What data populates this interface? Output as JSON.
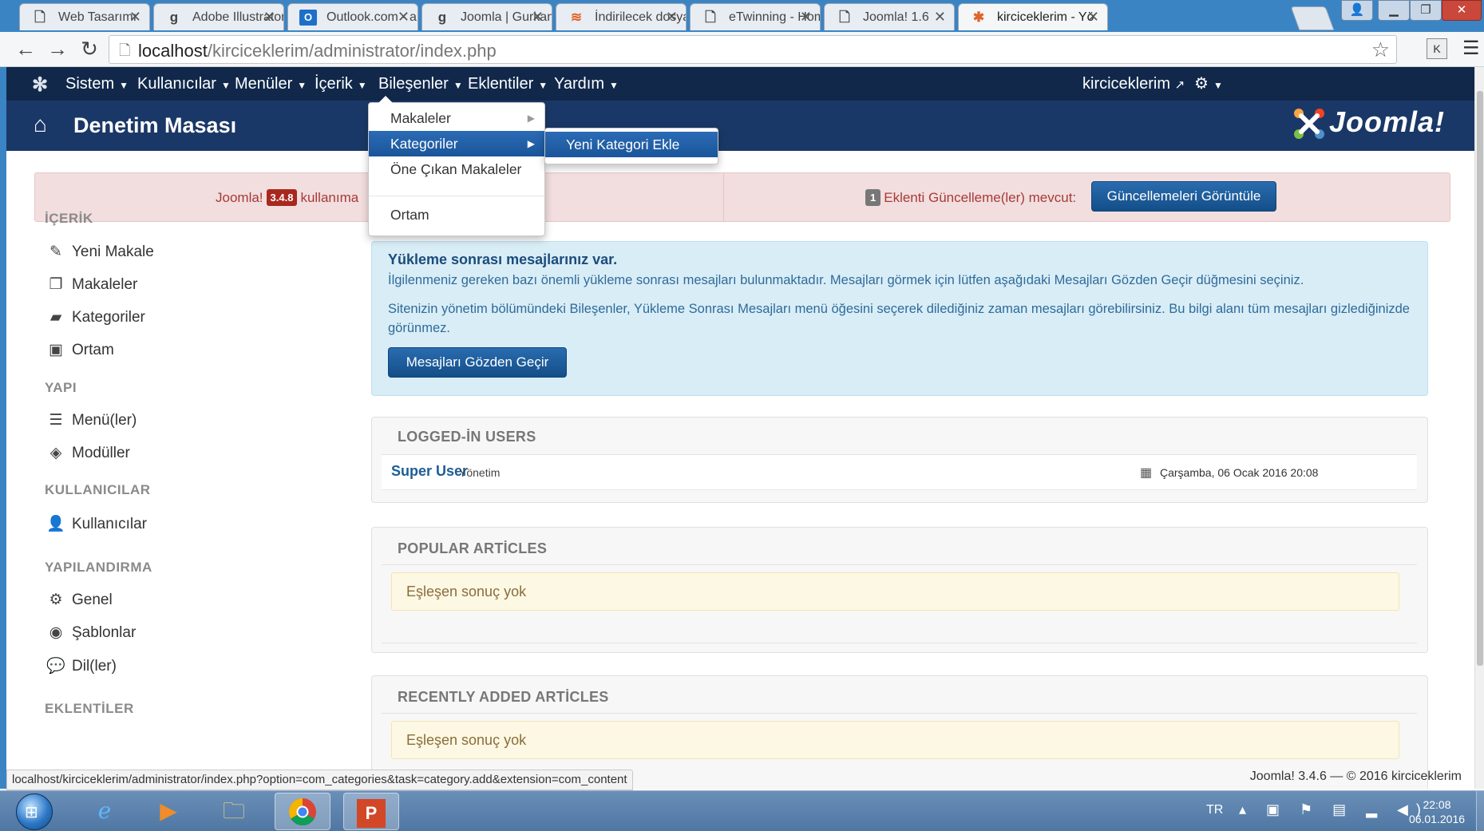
{
  "browser": {
    "tabs": [
      {
        "title": "Web Tasarımı",
        "icon": "page-icon"
      },
      {
        "title": "Adobe Illustrator",
        "icon": "g-icon"
      },
      {
        "title": "Outlook.com - ah",
        "icon": "outlook-icon"
      },
      {
        "title": "Joomla | Gurkanc",
        "icon": "g-icon"
      },
      {
        "title": "İndirilecek dosya",
        "icon": "stack-icon"
      },
      {
        "title": "eTwinning - Hom",
        "icon": "page-icon"
      },
      {
        "title": "Joomla! 1.6",
        "icon": "page-icon"
      },
      {
        "title": "kirciceklerim - Yö",
        "icon": "joomla-icon"
      }
    ],
    "url_host": "localhost",
    "url_path": "/kirciceklerim/administrator/index.php",
    "status_url": "localhost/kirciceklerim/administrator/index.php?option=com_categories&task=category.add&extension=com_content",
    "ext_label": "K"
  },
  "topmenu": {
    "items": [
      "Sistem",
      "Kullanıcılar",
      "Menüler",
      "İçerik",
      "Bileşenler",
      "Eklentiler",
      "Yardım"
    ],
    "site_link": "kirciceklerim"
  },
  "header": {
    "title": "Denetim Masası",
    "brand": "Joomla!"
  },
  "alert": {
    "left_prefix": "Joomla!",
    "version_badge": "3.4.8",
    "left_suffix": "kullanıma",
    "count_badge": "1",
    "right_text": "Eklenti Güncelleme(ler) mevcut:",
    "button": "Güncellemeleri Görüntüle"
  },
  "dropdown": {
    "items": [
      "Makaleler",
      "Kategoriler",
      "Öne Çıkan Makaleler",
      "Ortam"
    ],
    "submenu_item": "Yeni Kategori Ekle"
  },
  "sidebar": {
    "sections": [
      {
        "heading": "İÇERİK",
        "items": [
          {
            "label": "Yeni Makale",
            "icon": "pencil-icon"
          },
          {
            "label": "Makaleler",
            "icon": "copy-icon"
          },
          {
            "label": "Kategoriler",
            "icon": "folder-icon"
          },
          {
            "label": "Ortam",
            "icon": "image-icon"
          }
        ]
      },
      {
        "heading": "YAPI",
        "items": [
          {
            "label": "Menü(ler)",
            "icon": "list-icon"
          },
          {
            "label": "Modüller",
            "icon": "cube-icon"
          }
        ]
      },
      {
        "heading": "KULLANICILAR",
        "items": [
          {
            "label": "Kullanıcılar",
            "icon": "user-icon"
          }
        ]
      },
      {
        "heading": "YAPILANDIRMA",
        "items": [
          {
            "label": "Genel",
            "icon": "gear-icon"
          },
          {
            "label": "Şablonlar",
            "icon": "eye-icon"
          },
          {
            "label": "Dil(ler)",
            "icon": "comments-icon"
          }
        ]
      },
      {
        "heading": "EKLENTİLER",
        "items": []
      }
    ]
  },
  "postinstall": {
    "title": "Yükleme sonrası mesajlarınız var.",
    "p1": "İlgilenmeniz gereken bazı önemli yükleme sonrası mesajları bulunmaktadır. Mesajları görmek için lütfen aşağıdaki Mesajları Gözden Geçir düğmesini seçiniz.",
    "p2": "Sitenizin yönetim bölümündeki Bileşenler, Yükleme Sonrası Mesajları menü öğesini seçerek dilediğiniz zaman mesajları görebilirsiniz. Bu bilgi alanı tüm mesajları gizlediğinizde görünmez.",
    "button": "Mesajları Gözden Geçir"
  },
  "logged_users": {
    "title": "LOGGED-İN USERS",
    "user": "Super User",
    "role": "Yönetim",
    "date": "Çarşamba, 06 Ocak 2016 20:08"
  },
  "popular": {
    "title": "POPULAR ARTİCLES",
    "empty": "Eşleşen sonuç yok"
  },
  "recent": {
    "title": "RECENTLY ADDED ARTİCLES",
    "empty": "Eşleşen sonuç yok"
  },
  "footer": {
    "text": "Joomla! 3.4.6 — © 2016 kirciceklerim"
  },
  "taskbar": {
    "lang": "TR",
    "time": "22:08",
    "date": "06.01.2016"
  },
  "colors": {
    "nav_dark": "#11284b",
    "header_blue": "#1a3867",
    "highlight": "#1f5fa8",
    "alert_bg": "#f2dede",
    "info_bg": "#d9edf7"
  }
}
